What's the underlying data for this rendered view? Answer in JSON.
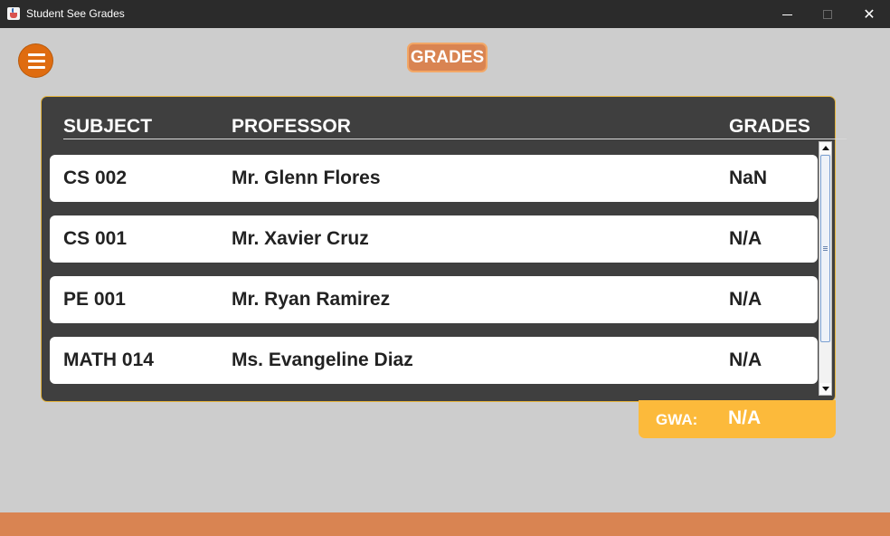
{
  "window": {
    "title": "Student See Grades",
    "minimize_icon": "minimize-icon",
    "maximize_icon": "maximize-icon",
    "close_symbol": "✕"
  },
  "header": {
    "title": "GRADES",
    "menu_icon": "hamburger-menu-icon"
  },
  "table": {
    "columns": [
      "SUBJECT",
      "PROFESSOR",
      "GRADES"
    ],
    "rows": [
      {
        "subject": "CS 002",
        "professor": "Mr. Glenn Flores",
        "grade": "NaN"
      },
      {
        "subject": "CS 001",
        "professor": "Mr. Xavier Cruz",
        "grade": "N/A"
      },
      {
        "subject": "PE 001",
        "professor": "Mr. Ryan Ramirez",
        "grade": "N/A"
      },
      {
        "subject": "MATH 014",
        "professor": "Ms. Evangeline Diaz",
        "grade": "N/A"
      }
    ]
  },
  "gwa": {
    "label": "GWA:",
    "value": "N/A"
  },
  "colors": {
    "background": "#cdcdcd",
    "panel": "#3f3f3f",
    "panel_border": "#e4b43c",
    "accent_orange": "#d98452",
    "menu_orange": "#df6c10",
    "gwa_yellow": "#fcba3b"
  }
}
